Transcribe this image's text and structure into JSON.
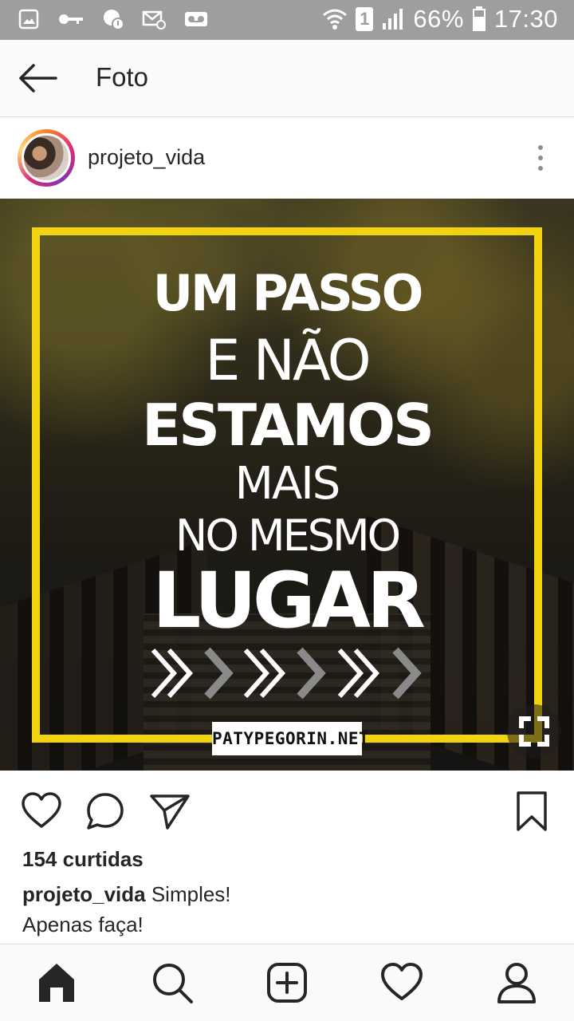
{
  "status_bar": {
    "battery": "66%",
    "time": "17:30",
    "sim_slot": "1",
    "icons": [
      "gallery-icon",
      "key-icon",
      "chat-notification-icon",
      "email-icon",
      "voicemail-icon",
      "wifi-icon",
      "sim-1-icon",
      "signal-icon",
      "battery-icon"
    ]
  },
  "header": {
    "title": "Foto",
    "back_icon": "arrow-left-icon"
  },
  "post": {
    "username": "projeto_vida",
    "more_icon": "vertical-dots-icon",
    "image": {
      "quote_lines": [
        "UM PASSO",
        "E NÃO",
        "ESTAMOS",
        "MAIS",
        "NO MESMO",
        "LUGAR"
      ],
      "site": "PATYPEGORIN.NET",
      "frame_color": "#f2d30f",
      "expand_icon": "expand-icon"
    },
    "actions": {
      "like_icon": "heart-icon",
      "comment_icon": "comment-icon",
      "share_icon": "send-icon",
      "save_icon": "bookmark-icon"
    },
    "likes": "154 curtidas",
    "caption_user": "projeto_vida",
    "caption_text": "Simples!",
    "caption_line2": "Apenas faça!"
  },
  "bottom_nav": {
    "items": [
      "home-icon",
      "search-icon",
      "add-post-icon",
      "activity-heart-icon",
      "profile-icon"
    ]
  }
}
